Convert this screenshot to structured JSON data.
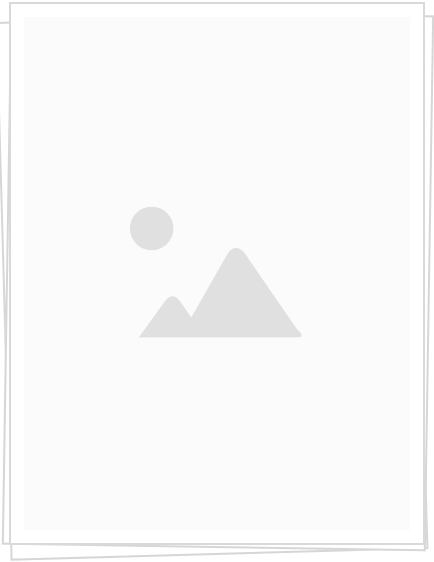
{
  "placeholder": {
    "icon": "image-placeholder-icon",
    "colors": {
      "frame_border": "#d6d6d6",
      "sheet_fill": "#ffffff",
      "inner_fill": "#fbfbfb",
      "glyph_fill": "#e0e0e0"
    }
  }
}
